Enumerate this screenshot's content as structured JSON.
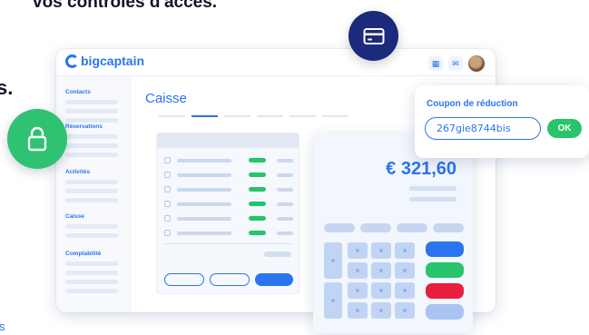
{
  "page": {
    "heading_fragment_top": "vos contrôles d'accès.",
    "heading_fragment_left": "s.",
    "link_fragment_bottom": "s"
  },
  "app": {
    "logo": "bigcaptain",
    "section_title": "Caisse"
  },
  "sidebar": {
    "groups": [
      {
        "label": "Contacts"
      },
      {
        "label": "Réservations"
      },
      {
        "label": "Activités"
      },
      {
        "label": "Caisse"
      },
      {
        "label": "Comptabilité"
      }
    ]
  },
  "till": {
    "amount": "€ 321,60"
  },
  "coupon": {
    "title": "Coupon de réduction",
    "code": "267gie8744bis",
    "ok_label": "OK"
  },
  "icons": {
    "credit_card": "credit-card-icon",
    "lock": "lock-icon",
    "calendar": "calendar-icon",
    "mail": "mail-icon"
  },
  "colors": {
    "brand_blue": "#2b74ef",
    "navy": "#1b2a7a",
    "green": "#27c46b",
    "red": "#e91e3e"
  }
}
